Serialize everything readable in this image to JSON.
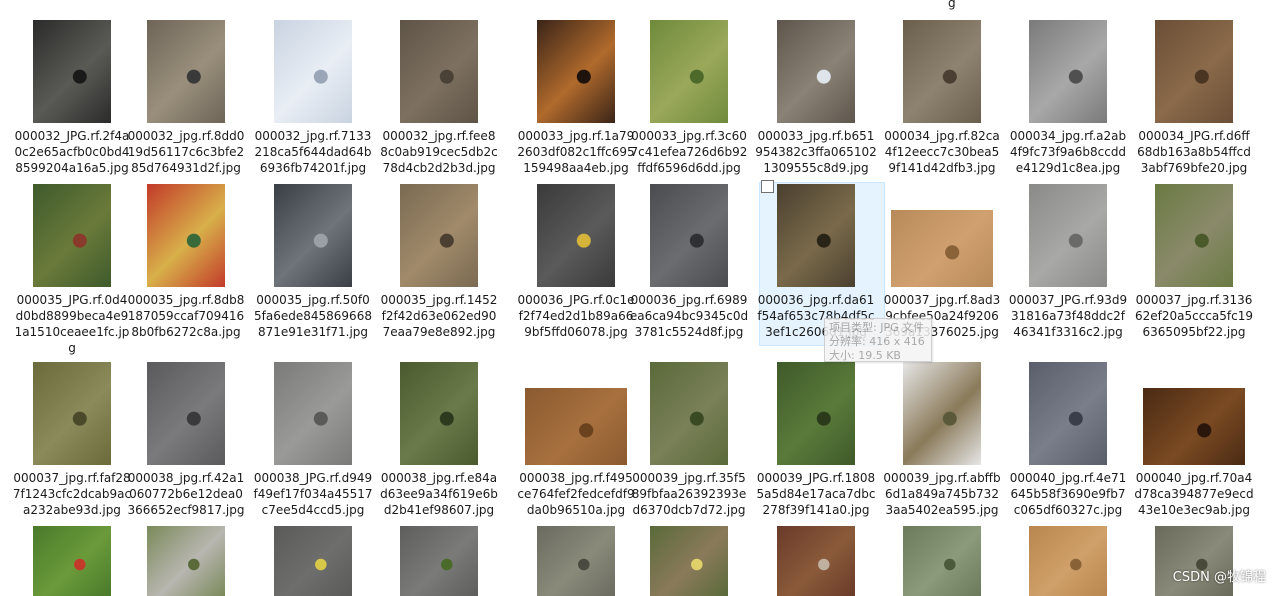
{
  "top_overflow_char": "g",
  "rows": [
    [
      {
        "name": "000032_JPG.rf.2f4a0c2e65acfb0c0bd48599204a16a5.jpg",
        "lines": [
          "000032_JPG.rf.2f4a",
          "0c2e65acfb0c0bd4",
          "8599204a16a5.jpg"
        ],
        "colors": [
          "#2b2b2b",
          "#5a5a55",
          "#1a1a1a"
        ]
      },
      {
        "name": "000032_jpg.rf.8dd019d56117c6c3bfe285d764931d2f.jpg",
        "lines": [
          "000032_jpg.rf.8dd0",
          "19d56117c6c3bfe2",
          "85d764931d2f.jpg"
        ],
        "colors": [
          "#6e6558",
          "#9a8f7c",
          "#3a3a3a"
        ]
      },
      {
        "name": "000032_jpg.rf.7133218ca5f644dad64b6936fb74201f.jpg",
        "lines": [
          "000032_jpg.rf.7133",
          "218ca5f644dad64b",
          "6936fb74201f.jpg"
        ],
        "colors": [
          "#c9d3e0",
          "#e9eef5",
          "#9aa6b8"
        ]
      },
      {
        "name": "000032_jpg.rf.fee88c0ab919cec5db2c78d4cb2d2b3d.jpg",
        "lines": [
          "000032_jpg.rf.fee8",
          "8c0ab919cec5db2c",
          "78d4cb2d2b3d.jpg"
        ],
        "colors": [
          "#5e5446",
          "#7d7060",
          "#4a4236"
        ]
      },
      {
        "name": "000033_jpg.rf.1a792603df082c1ffc695159498aa4eb.jpg",
        "lines": [
          "000033_jpg.rf.1a79",
          "2603df082c1ffc695",
          "159498aa4eb.jpg"
        ],
        "colors": [
          "#3a2418",
          "#b06a2c",
          "#1e120c"
        ]
      },
      {
        "name": "000033_jpg.rf.3c607c41efea726d6b92ffdf6596d6dd.jpg",
        "lines": [
          "000033_jpg.rf.3c60",
          "7c41efea726d6b92",
          "ffdf6596d6dd.jpg"
        ],
        "colors": [
          "#6f8a3c",
          "#9aa85a",
          "#4e6a2a"
        ]
      },
      {
        "name": "000033_jpg.rf.b651954382c3ffa0651021309555c8d9.jpg",
        "lines": [
          "000033_jpg.rf.b651",
          "954382c3ffa065102",
          "1309555c8d9.jpg"
        ],
        "colors": [
          "#5e564c",
          "#8a8276",
          "#dfe3ea"
        ]
      },
      {
        "name": "000034_jpg.rf.82ca4f12eecc7c30bea59f141d42dfb3.jpg",
        "lines": [
          "000034_jpg.rf.82ca",
          "4f12eecc7c30bea5",
          "9f141d42dfb3.jpg"
        ],
        "colors": [
          "#6a5e4c",
          "#8e8270",
          "#4a3f32"
        ]
      },
      {
        "name": "000034_jpg.rf.a2ab4f9fc73f9a6b8ccdde4129d1c8ea.jpg",
        "lines": [
          "000034_jpg.rf.a2ab",
          "4f9fc73f9a6b8ccdd",
          "e4129d1c8ea.jpg"
        ],
        "colors": [
          "#7a7a7a",
          "#a8a8a8",
          "#505050"
        ]
      },
      {
        "name": "000034_JPG.rf.d6ff68db163a8b54ffcd3abf769bfe20.jpg",
        "lines": [
          "000034_JPG.rf.d6ff",
          "68db163a8b54ffcd",
          "3abf769bfe20.jpg"
        ],
        "colors": [
          "#6a4e36",
          "#8a6a4a",
          "#4a3422"
        ]
      }
    ],
    [
      {
        "name": "000035_JPG.rf.0d4d0bd8899beca4e91a1510ceaee1fc.jpg",
        "lines": [
          "000035_JPG.rf.0d4",
          "d0bd8899beca4e9",
          "1a1510ceaee1fc.jp",
          "g"
        ],
        "colors": [
          "#3e5a2c",
          "#6a7a3a",
          "#8a3a2a"
        ]
      },
      {
        "name": "000035_jpg.rf.8db8187059ccaf7094168b0fb6272c8a.jpg",
        "lines": [
          "000035_jpg.rf.8db8",
          "187059ccaf709416",
          "8b0fb6272c8a.jpg"
        ],
        "colors": [
          "#c23a2a",
          "#d8b04a",
          "#3a6a3a"
        ]
      },
      {
        "name": "000035_jpg.rf.50f05fa6ede845869668871e91e31f71.jpg",
        "lines": [
          "000035_jpg.rf.50f0",
          "5fa6ede845869668",
          "871e91e31f71.jpg"
        ],
        "colors": [
          "#3a3f46",
          "#6e747a",
          "#9aa0a6"
        ]
      },
      {
        "name": "000035_jpg.rf.1452f2f42d63e062ed907eaa79e8e892.jpg",
        "lines": [
          "000035_jpg.rf.1452",
          "f2f42d63e062ed90",
          "7eaa79e8e892.jpg"
        ],
        "colors": [
          "#7a6a52",
          "#a08a6a",
          "#4a3f30"
        ]
      },
      {
        "name": "000036_JPG.rf.0c1ef2f74ed2d1b89a669bf5ffd06078.jpg",
        "lines": [
          "000036_JPG.rf.0c1e",
          "f2f74ed2d1b89a66",
          "9bf5ffd06078.jpg"
        ],
        "colors": [
          "#3a3a3a",
          "#5a5a5a",
          "#d6b43a"
        ]
      },
      {
        "name": "000036_jpg.rf.6989ea6ca94bc9345c0d3781c5524d8f.jpg",
        "lines": [
          "000036_jpg.rf.6989",
          "ea6ca94bc9345c0d",
          "3781c5524d8f.jpg"
        ],
        "colors": [
          "#4a4c50",
          "#6a6c70",
          "#2e3034"
        ]
      },
      {
        "name": "000036_jpg.rf.da61f54af653c78b4df5c3ef1c2606d1.jpg",
        "lines": [
          "000036_jpg.rf.da61",
          "f54af653c78b4df5c",
          "3ef1c2606d1.jpg"
        ],
        "colors": [
          "#4a4030",
          "#7a6a4a",
          "#2a2418"
        ]
      },
      {
        "name": "000037_jpg.rf.8ad39cbfee50a24f9206369a13376025.jpg",
        "lines": [
          "000037_jpg.rf.8ad3",
          "9cbfee50a24f9206",
          "369a13376025.jpg"
        ],
        "colors": [
          "#b88a5a",
          "#d0a070",
          "#8a6238"
        ]
      },
      {
        "name": "000037_JPG.rf.93d931816a73f48ddc2f46341f3316c2.jpg",
        "lines": [
          "000037_JPG.rf.93d9",
          "31816a73f48ddc2f",
          "46341f3316c2.jpg"
        ],
        "colors": [
          "#8a8a88",
          "#a8a8a6",
          "#6a6a68"
        ]
      },
      {
        "name": "000037_jpg.rf.313662ef20a5ccca5fc196365095bf22.jpg",
        "lines": [
          "000037_jpg.rf.3136",
          "62ef20a5ccca5fc19",
          "6365095bf22.jpg"
        ],
        "colors": [
          "#6a7a42",
          "#8a8a6a",
          "#4a5a2a"
        ]
      }
    ],
    [
      {
        "name": "000037_jpg.rf.faf287f1243cfc2dcab9aca232abe93d.jpg",
        "lines": [
          "000037_jpg.rf.faf28",
          "7f1243cfc2dcab9ac",
          "a232abe93d.jpg"
        ],
        "colors": [
          "#6a6a3a",
          "#8a8a5a",
          "#4a4a2a"
        ]
      },
      {
        "name": "000038_jpg.rf.42a1060772b6e12dea0366652ecf9817.jpg",
        "lines": [
          "000038_jpg.rf.42a1",
          "060772b6e12dea0",
          "366652ecf9817.jpg"
        ],
        "colors": [
          "#5a5a5c",
          "#7a7a7c",
          "#3a3a3c"
        ]
      },
      {
        "name": "000038_JPG.rf.d949f49ef17f034a45517c7ee5d4ccd5.jpg",
        "lines": [
          "000038_JPG.rf.d949",
          "f49ef17f034a45517",
          "c7ee5d4ccd5.jpg"
        ],
        "colors": [
          "#7a7a78",
          "#9a9a98",
          "#5a5a58"
        ]
      },
      {
        "name": "000038_jpg.rf.e84ad63ee9a34f619e6bd2b41ef98607.jpg",
        "lines": [
          "000038_jpg.rf.e84a",
          "d63ee9a34f619e6b",
          "d2b41ef98607.jpg"
        ],
        "colors": [
          "#4a5a2e",
          "#6a7a4a",
          "#2e3a1e"
        ]
      },
      {
        "name": "000038_jpg.rf.f495ce764fef2fedcefdf9da0b96510a.jpg",
        "lines": [
          "000038_jpg.rf.f495",
          "ce764fef2fedcefdf9",
          "da0b96510a.jpg"
        ],
        "colors": [
          "#8a5a30",
          "#a8703e",
          "#6a421e"
        ]
      },
      {
        "name": "000039_jpg.rf.35f589fbfaa26392393ed6370dcb7d72.jpg",
        "lines": [
          "000039_jpg.rf.35f5",
          "89fbfaa26392393e",
          "d6370dcb7d72.jpg"
        ],
        "colors": [
          "#5a6a3a",
          "#7a8058",
          "#3a4a22"
        ]
      },
      {
        "name": "000039_JPG.rf.18085a5d84e17aca7dbc278f39f141a0.jpg",
        "lines": [
          "000039_JPG.rf.1808",
          "5a5d84e17aca7dbc",
          "278f39f141a0.jpg"
        ],
        "colors": [
          "#3e5a2a",
          "#5a7a3a",
          "#2a3a1a"
        ]
      },
      {
        "name": "000039_jpg.rf.abffb6d1a849a745b7323aa5402ea595.jpg",
        "lines": [
          "000039_jpg.rf.abffb",
          "6d1a849a745b732",
          "3aa5402ea595.jpg"
        ],
        "colors": [
          "#e6e6e6",
          "#8a7a5a",
          "#5a5a3a"
        ]
      },
      {
        "name": "000040_jpg.rf.4e71645b58f3690e9fb7c065df60327c.jpg",
        "lines": [
          "000040_jpg.rf.4e71",
          "645b58f3690e9fb7",
          "c065df60327c.jpg"
        ],
        "colors": [
          "#5a5e6a",
          "#7a7e8a",
          "#3a3e4a"
        ]
      },
      {
        "name": "000040_jpg.rf.70a4d78ca394877e9ecd43e10e3ec9ab.jpg",
        "lines": [
          "000040_jpg.rf.70a4",
          "d78ca394877e9ecd",
          "43e10e3ec9ab.jpg"
        ],
        "colors": [
          "#4a2a14",
          "#7a4a22",
          "#2a160a"
        ]
      }
    ],
    [
      {
        "name": "",
        "lines": [],
        "colors": [
          "#4a7a2a",
          "#6a9a3a",
          "#c23a2a"
        ]
      },
      {
        "name": "",
        "lines": [],
        "colors": [
          "#7a8a5a",
          "#b8b6b0",
          "#5a6a3a"
        ]
      },
      {
        "name": "",
        "lines": [],
        "colors": [
          "#5a5a58",
          "#6e6e6c",
          "#d8c84a"
        ]
      },
      {
        "name": "",
        "lines": [],
        "colors": [
          "#5e5e5c",
          "#7a7a78",
          "#4a6a2a"
        ]
      },
      {
        "name": "",
        "lines": [],
        "colors": [
          "#6a6a60",
          "#8a8a7a",
          "#4a4a40"
        ]
      },
      {
        "name": "",
        "lines": [],
        "colors": [
          "#5a6a3a",
          "#8a7a5a",
          "#e0d06a"
        ]
      },
      {
        "name": "",
        "lines": [],
        "colors": [
          "#6a3a2a",
          "#8a5a3a",
          "#c0b0a0"
        ]
      },
      {
        "name": "",
        "lines": [],
        "colors": [
          "#6a7a5a",
          "#8a9a7a",
          "#4a5a3a"
        ]
      },
      {
        "name": "",
        "lines": [],
        "colors": [
          "#b8864e",
          "#d0a06a",
          "#8a6238"
        ]
      },
      {
        "name": "",
        "lines": [],
        "colors": [
          "#6a6a5a",
          "#8a8a7a",
          "#4a4a3a"
        ]
      }
    ]
  ],
  "tooltip": {
    "lines": [
      "项目类型: JPG 文件",
      "分辨率: 416 x 416",
      "大小: 19.5 KB"
    ]
  },
  "watermark": "CSDN @牧锦程"
}
